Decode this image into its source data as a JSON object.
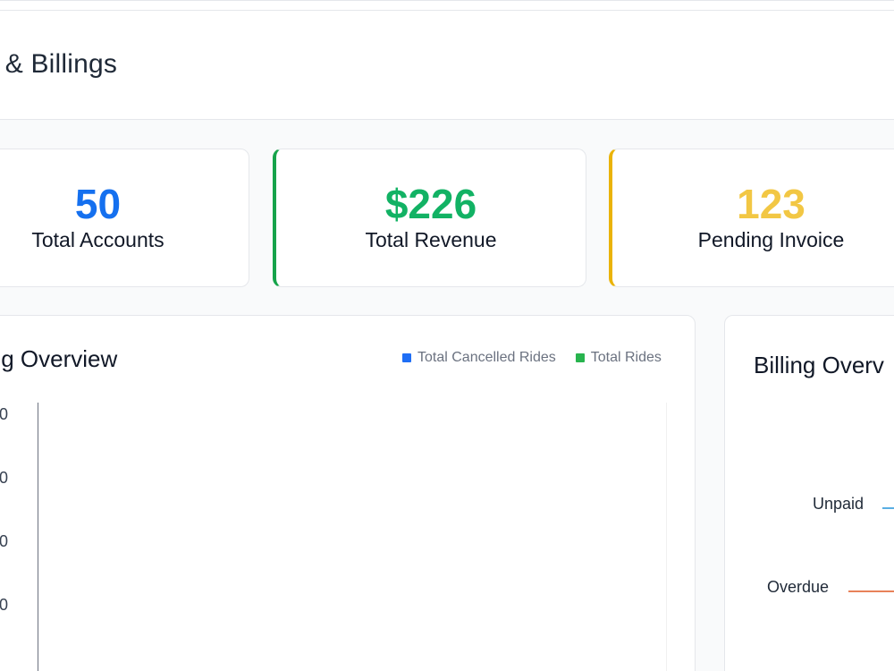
{
  "header": {
    "title": "ount & Billings"
  },
  "stats": [
    {
      "value": "50",
      "label": "Total Accounts",
      "color": "#1570ef"
    },
    {
      "value": "$226",
      "label": "Total Revenue",
      "color": "#12b264"
    },
    {
      "value": "123",
      "label": "Pending Invoice",
      "color": "#f2c744"
    }
  ],
  "billing_chart": {
    "title": "ing Overview",
    "legend": [
      {
        "name": "Total Cancelled Rides",
        "color": "#1f6ef5"
      },
      {
        "name": "Total Rides",
        "color": "#28b44e"
      }
    ],
    "y_ticks": [
      "0",
      "0",
      "0",
      "0"
    ]
  },
  "status_chart": {
    "title": "Billing Overv",
    "labels": [
      {
        "text": "Unpaid",
        "color": "#5aaee3"
      },
      {
        "text": "Overdue",
        "color": "#e8825a"
      }
    ]
  }
}
